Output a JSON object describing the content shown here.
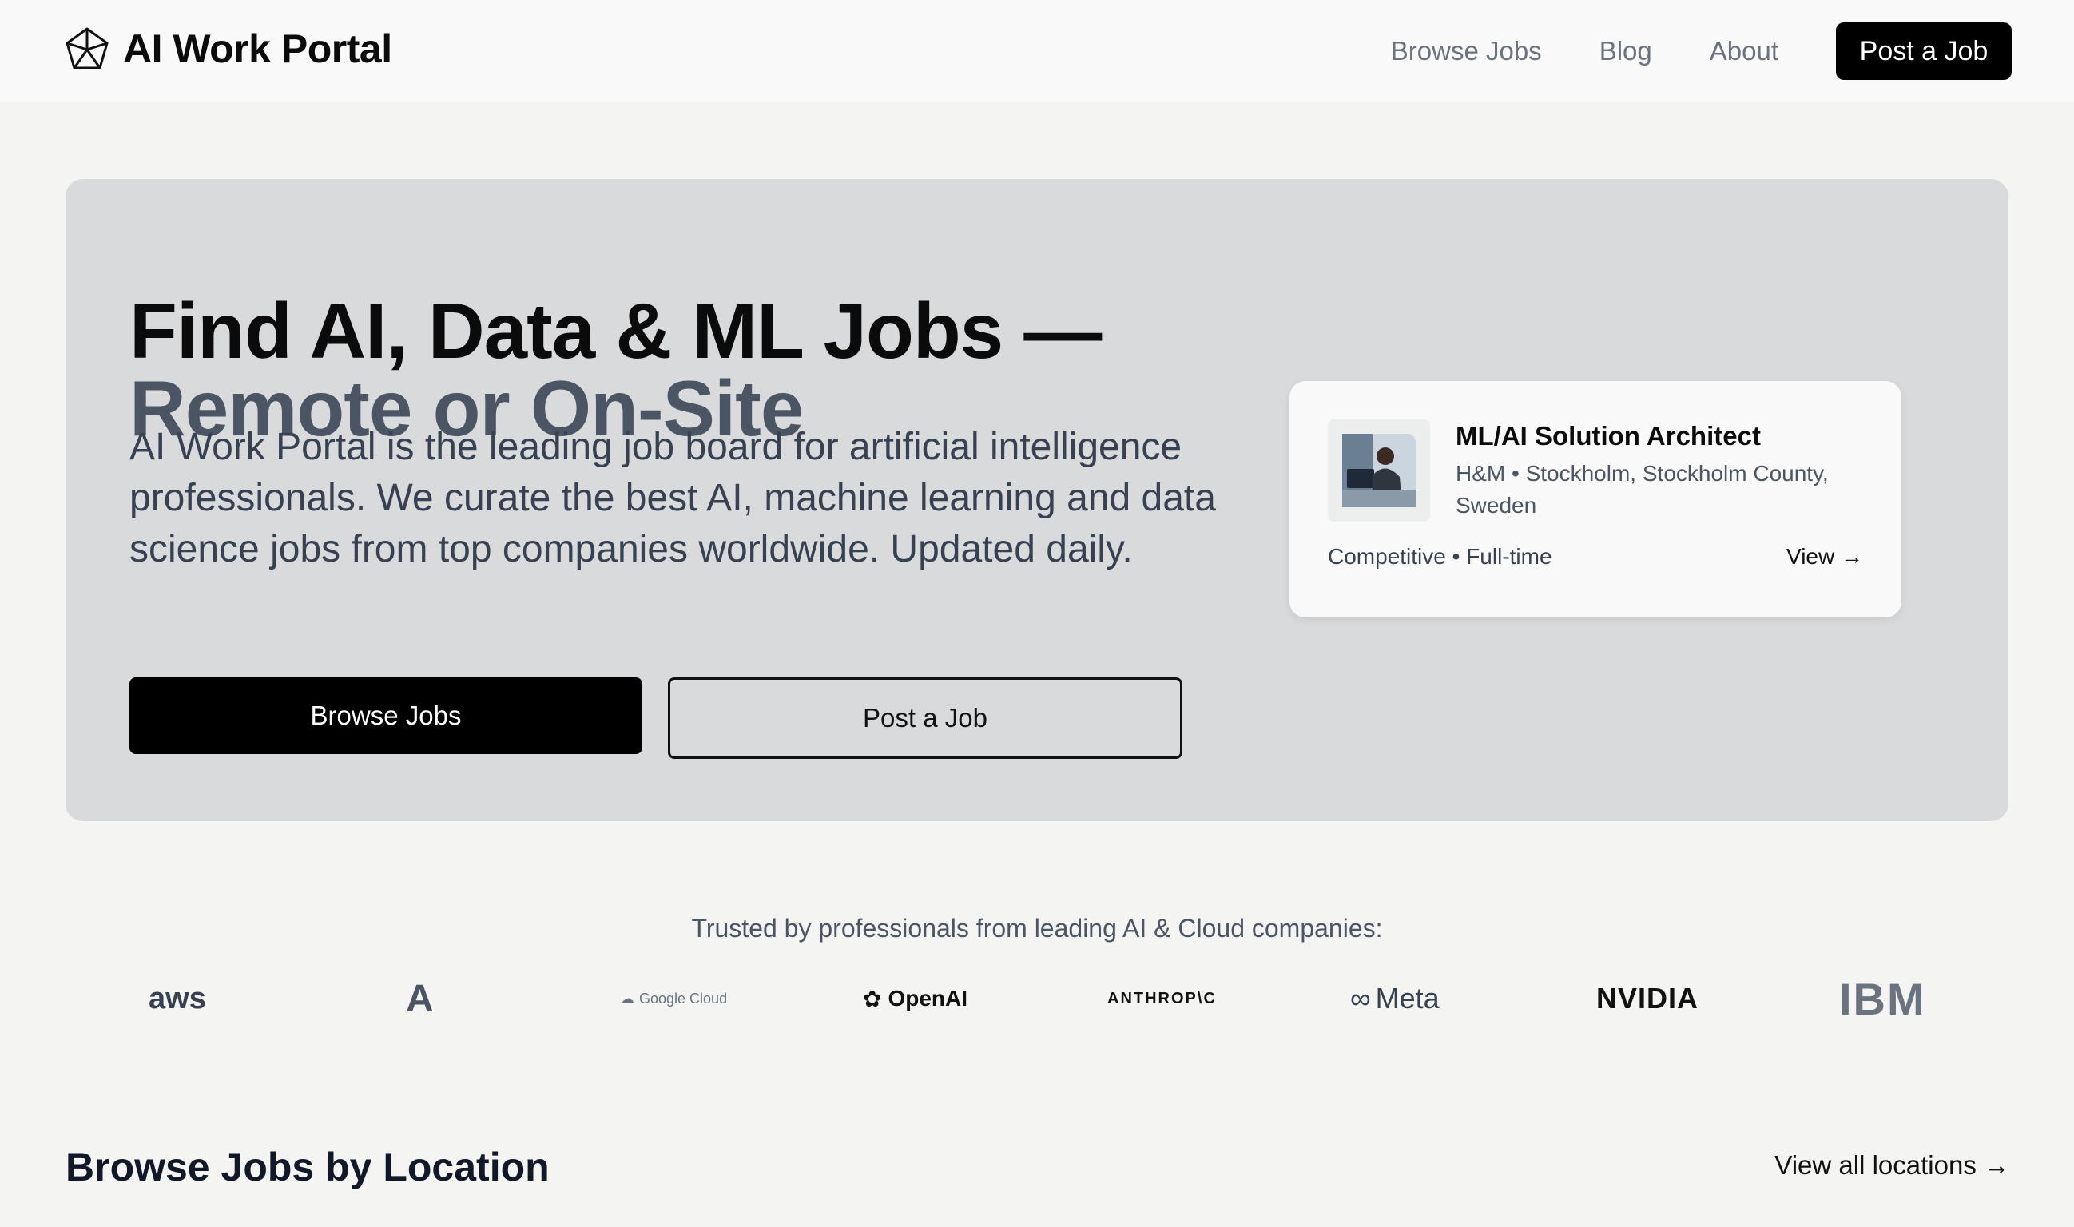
{
  "header": {
    "brand": "AI Work Portal",
    "nav": [
      "Browse Jobs",
      "Blog",
      "About"
    ],
    "cta": "Post a Job"
  },
  "hero": {
    "title_line1": "Find AI, Data & ML Jobs —",
    "title_line2": "Remote or On-Site",
    "description": "AI Work Portal is the leading job board for artificial intelligence professionals. We curate the best AI, machine learning and data science jobs from top companies worldwide. Updated daily.",
    "primary_button": "Browse Jobs",
    "secondary_button": "Post a Job"
  },
  "featured_job": {
    "title": "ML/AI Solution Architect",
    "company_location": "H&M • Stockholm, Stockholm County, Sweden",
    "compensation_type": "Competitive • Full-time",
    "view": "View →"
  },
  "trusted": {
    "text": "Trusted by professionals from leading AI & Cloud companies:",
    "logos": [
      "aws",
      "A",
      "Google Cloud",
      "OpenAI",
      "ANTHROP\\C",
      "Meta",
      "NVIDIA",
      "IBM"
    ]
  },
  "locations": {
    "title": "Browse Jobs by Location",
    "view_all": "View all locations →"
  },
  "colors": {
    "page_bg": "#f4f4f3",
    "hero_bg": "#d9dadc",
    "primary": "#000000",
    "muted_text": "#4b5563"
  }
}
